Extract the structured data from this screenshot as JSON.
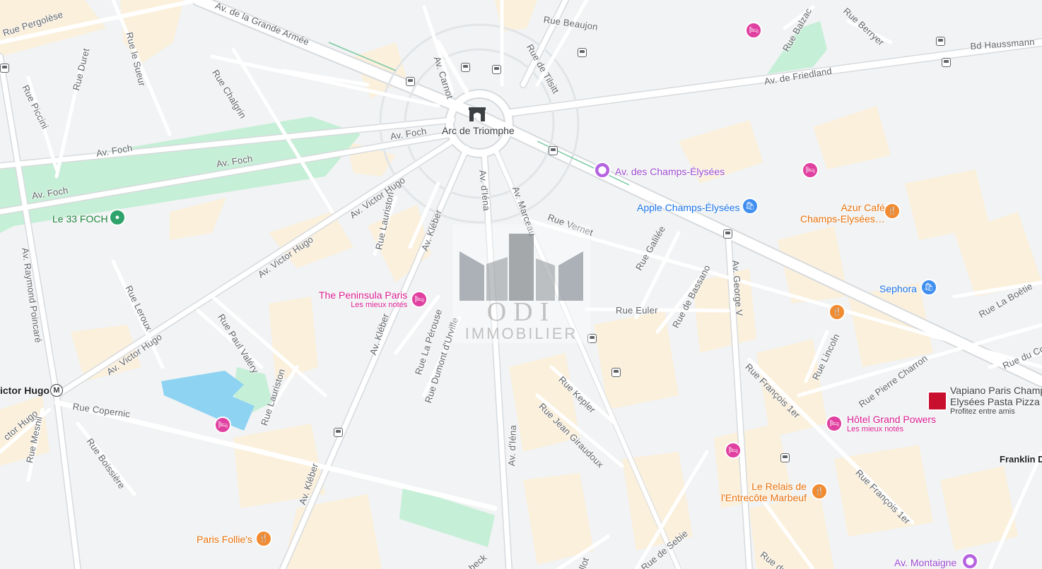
{
  "map": {
    "streets": [
      {
        "id": "grande-armee",
        "name": "Av. de la Grande Armée"
      },
      {
        "id": "pergolese",
        "name": "Rue Pergolèse"
      },
      {
        "id": "le-sueur",
        "name": "Rue le Sueur"
      },
      {
        "id": "duret",
        "name": "Rue Duret"
      },
      {
        "id": "piccini",
        "name": "Rue Piccini"
      },
      {
        "id": "chalgrin",
        "name": "Rue Chalgrin"
      },
      {
        "id": "foch1",
        "name": "Av. Foch"
      },
      {
        "id": "foch2",
        "name": "Av. Foch"
      },
      {
        "id": "foch3",
        "name": "Av. Foch"
      },
      {
        "id": "foch4",
        "name": "Av. Foch"
      },
      {
        "id": "carnot",
        "name": "Av. Carnot"
      },
      {
        "id": "beaujon",
        "name": "Rue Beaujon"
      },
      {
        "id": "tilsitt",
        "name": "Rue de Tilsitt"
      },
      {
        "id": "balzac",
        "name": "Rue Balzac"
      },
      {
        "id": "berryer",
        "name": "Rue Berryer"
      },
      {
        "id": "haussmann",
        "name": "Bd Haussmann"
      },
      {
        "id": "friedland",
        "name": "Av. de Friedland"
      },
      {
        "id": "iena1",
        "name": "Av. d'Iéna"
      },
      {
        "id": "marceau",
        "name": "Av. Marceau"
      },
      {
        "id": "kleber1",
        "name": "Av. Kléber"
      },
      {
        "id": "lauriston1",
        "name": "Rue Lauriston"
      },
      {
        "id": "victor-hugo1",
        "name": "Av. Victor Hugo"
      },
      {
        "id": "victor-hugo2",
        "name": "Av. Victor Hugo"
      },
      {
        "id": "victor-hugo3",
        "name": "Av. Victor Hugo"
      },
      {
        "id": "victor-hugo4",
        "name": "ctor Hugo"
      },
      {
        "id": "raymond-poincare",
        "name": "Av. Raymond Poincaré"
      },
      {
        "id": "leroux",
        "name": "Rue Leroux"
      },
      {
        "id": "paul-valery",
        "name": "Rue Paul Valéry"
      },
      {
        "id": "lauriston2",
        "name": "Rue Lauriston"
      },
      {
        "id": "copernic",
        "name": "Rue Copernic"
      },
      {
        "id": "mesnil",
        "name": "Rue Mesnil"
      },
      {
        "id": "boissiere",
        "name": "Rue Boissière"
      },
      {
        "id": "kleber2",
        "name": "Av. Kléber"
      },
      {
        "id": "kleber3",
        "name": "Av. Kléber"
      },
      {
        "id": "la-perouse",
        "name": "Rue La Pérouse"
      },
      {
        "id": "dumont-durville",
        "name": "Rue Dumont d'Urville"
      },
      {
        "id": "iena2",
        "name": "Av. d'Iéna"
      },
      {
        "id": "vernet",
        "name": "Rue Vernet"
      },
      {
        "id": "galilee",
        "name": "Rue Galilée"
      },
      {
        "id": "euler",
        "name": "Rue Euler"
      },
      {
        "id": "bassano",
        "name": "Rue de Bassano"
      },
      {
        "id": "george-v",
        "name": "Av. George V"
      },
      {
        "id": "kepler",
        "name": "Rue Kepler"
      },
      {
        "id": "jean-giraudoux",
        "name": "Rue Jean Giraudoux"
      },
      {
        "id": "francois1",
        "name": "Rue François 1er"
      },
      {
        "id": "francois2",
        "name": "Rue François 1er"
      },
      {
        "id": "lincoln",
        "name": "Rue Lincoln"
      },
      {
        "id": "pierre-charron",
        "name": "Rue Pierre Charron"
      },
      {
        "id": "la-boetie",
        "name": "Rue La Boétie"
      },
      {
        "id": "du-colis",
        "name": "Rue du Colis"
      },
      {
        "id": "sebbie",
        "name": "Rue de Sebie"
      },
      {
        "id": "becbeck",
        "name": "beck"
      },
      {
        "id": "tilott",
        "name": "llot"
      },
      {
        "id": "rue-du",
        "name": "Rue du F"
      }
    ],
    "places": {
      "arc": {
        "name": "Arc de Triomphe"
      },
      "champs": {
        "name": "Av. des Champs-Élysées"
      },
      "apple": {
        "name": "Apple Champs-Élysées"
      },
      "azur": {
        "line1": "Azur Café",
        "line2": "Champs-Elysées…"
      },
      "sephora": {
        "name": "Sephora"
      },
      "foch33": {
        "name": "Le 33 FOCH"
      },
      "peninsula": {
        "name": "The Peninsula Paris",
        "sub": "Les mieux notés"
      },
      "grand-powers": {
        "name": "Hôtel Grand Powers",
        "sub": "Les mieux notés"
      },
      "vapiano": {
        "line1": "Vapiano Paris Champ",
        "line2": "Elysées Pasta Pizza B",
        "sub": "Profitez entre amis"
      },
      "relais": {
        "line1": "Le Relais de",
        "line2": "l'Entrecôte Marbeuf"
      },
      "follies": {
        "name": "Paris Follie's"
      },
      "montaigne": {
        "name": "Av. Montaigne"
      },
      "franklin": {
        "name": "Franklin D"
      },
      "victor-hugo-metro": {
        "name": "ictor Hugo"
      }
    },
    "watermark": {
      "line1": "ODI",
      "line2": "IMMOBILIER"
    },
    "colors": {
      "park": "#c6efd7",
      "water": "#8fd3f3",
      "block": "#fbf0dc",
      "road": "#ffffff",
      "road_border": "#d7dadd",
      "hotel": "#e040a0",
      "food": "#f28b30",
      "shop": "#3f8ef0",
      "attraction": "#b563e0"
    }
  }
}
